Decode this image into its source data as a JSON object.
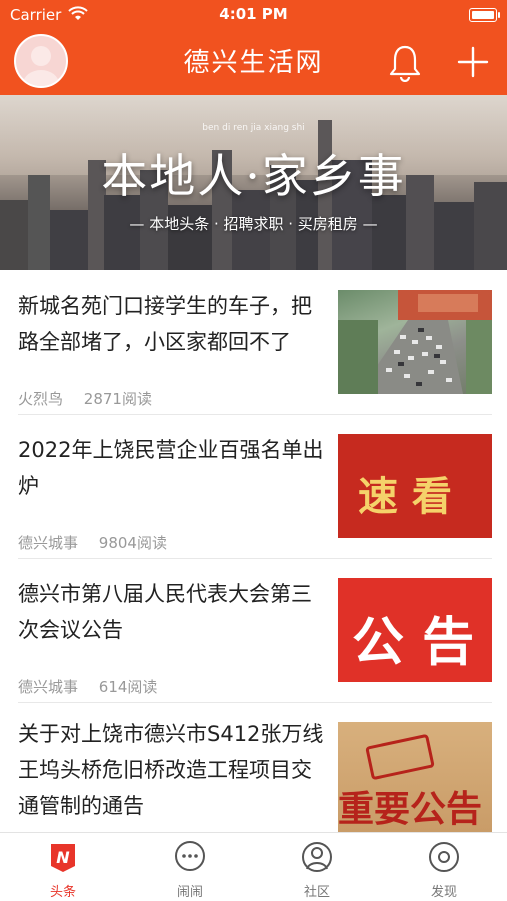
{
  "status_bar": {
    "carrier": "Carrier",
    "time": "4:01 PM"
  },
  "header": {
    "title": "德兴生活网"
  },
  "banner": {
    "pinyin": "ben di ren jia xiang shi",
    "headline": "本地人·家乡事",
    "subline": "— 本地头条 · 招聘求职 · 买房租房 —"
  },
  "news": [
    {
      "title": "新城名苑门口接学生的车子，把路全部堵了，小区家都回不了",
      "source": "火烈鸟",
      "reads": "2871阅读"
    },
    {
      "title": "2022年上饶民营企业百强名单出炉",
      "source": "德兴城事",
      "reads": "9804阅读",
      "thumb_text": "速 看"
    },
    {
      "title": "德兴市第八届人民代表大会第三次会议公告",
      "source": "德兴城事",
      "reads": "614阅读",
      "thumb_text": "公 告"
    },
    {
      "title": "关于对上饶市德兴市S412张万线王坞头桥危旧桥改造工程项目交通管制的通告",
      "thumb_text": "重要公告"
    }
  ],
  "tabs": [
    {
      "label": "头条",
      "icon": "news-n-icon",
      "active": true
    },
    {
      "label": "闹闹",
      "icon": "chat-bubble-icon",
      "active": false
    },
    {
      "label": "社区",
      "icon": "community-icon",
      "active": false
    },
    {
      "label": "发现",
      "icon": "discover-icon",
      "active": false
    }
  ],
  "colors": {
    "header_bg": "#f1521f",
    "active_tab": "#e8352a",
    "meta_text": "#999999"
  }
}
